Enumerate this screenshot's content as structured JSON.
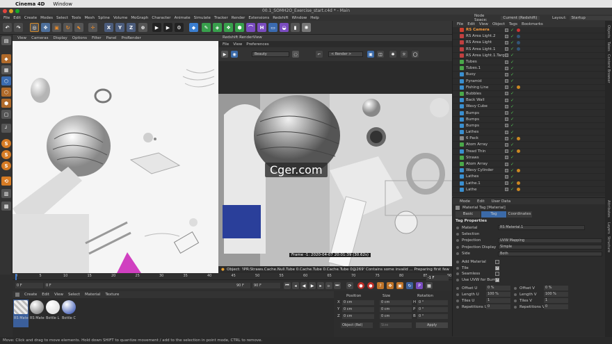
{
  "macmenu": {
    "app": "Cinema 4D",
    "window": "Window"
  },
  "window_title": "00.1_SOMH2O_Exercise_start.c4d * - Main",
  "appmenu": [
    "File",
    "Edit",
    "Create",
    "Modes",
    "Select",
    "Tools",
    "Mesh",
    "Spline",
    "Volume",
    "MoGraph",
    "Character",
    "Animate",
    "Simulate",
    "Tracker",
    "Render",
    "Extensions",
    "Redshift",
    "Window",
    "Help"
  ],
  "nodespace": {
    "label": "Node Space:",
    "value": "Current (Redshift)"
  },
  "layout": {
    "label": "Layout:",
    "value": "Startup"
  },
  "axes": [
    "X",
    "Y",
    "Z"
  ],
  "viewport_menu": [
    "View",
    "Cameras",
    "Display",
    "Options",
    "Filter",
    "Panel",
    "ProRender"
  ],
  "renderview": {
    "title": "Redshift RenderView",
    "menu": [
      "File",
      "View",
      "Preferences"
    ],
    "aov": "Beauty",
    "camera": "< Render >",
    "frame_info": "Frame -1:  2020-04-07  20:01:39  (30.62s)",
    "status": "Object: 'IPR:Straws.Cache.Null.Tube 0.Cache.Tube 0.Cache.Tube 0@269' Contains some invalid ...   Preparing first few levels of ray tr"
  },
  "watermark": "Cger.com",
  "timeline": {
    "ticks": [
      "0",
      "5",
      "10",
      "15",
      "20",
      "25",
      "30",
      "35",
      "40",
      "45",
      "50",
      "55",
      "60",
      "65",
      "70",
      "75",
      "80",
      "85",
      "90"
    ],
    "start": "0 F",
    "current": "0 F",
    "end": "90 F",
    "end2": "90 F",
    "frame_field": "-1 F"
  },
  "material_menu": [
    "Create",
    "Edit",
    "View",
    "Select",
    "Material",
    "Texture"
  ],
  "materials": [
    {
      "label": "RS Mate",
      "color": "#cfcfcf"
    },
    {
      "label": "RS Mate",
      "color": "#6a6a6a"
    },
    {
      "label": "Bottle L",
      "color": "#d8d8d8"
    },
    {
      "label": "Bottle C",
      "color": "#1e3fa8"
    }
  ],
  "coords": {
    "headers": [
      "Position",
      "Size",
      "Rotation"
    ],
    "rows": [
      {
        "axis": "X",
        "pos": "0 cm",
        "size": "0 cm",
        "rot_label": "H",
        "rot": "0 °"
      },
      {
        "axis": "Y",
        "pos": "0 cm",
        "size": "0 cm",
        "rot_label": "P",
        "rot": "0 °"
      },
      {
        "axis": "Z",
        "pos": "0 cm",
        "size": "0 cm",
        "rot_label": "B",
        "rot": "0 °"
      }
    ],
    "mode": "Object (Rel)",
    "size_mode": "Size",
    "apply": "Apply"
  },
  "object_menu": [
    "File",
    "Edit",
    "View",
    "Object",
    "Tags",
    "Bookmarks"
  ],
  "objects": [
    {
      "name": "RS Camera",
      "color": "#d04030",
      "tag": "#c33",
      "highlight": true
    },
    {
      "name": "RS Area Light.2",
      "color": "#c04040",
      "tag": "#357"
    },
    {
      "name": "RS Area Light",
      "color": "#c04040",
      "tag": "#357"
    },
    {
      "name": "RS Area Light.1",
      "color": "#c04040",
      "tag": "#357"
    },
    {
      "name": "RS Area Light.1.Target",
      "color": "#c04040",
      "tag": ""
    },
    {
      "name": "Tubes",
      "color": "#4aa84a",
      "tag": ""
    },
    {
      "name": "Tubes.1",
      "color": "#4aa84a",
      "tag": ""
    },
    {
      "name": "Buoy",
      "color": "#3a8fd0",
      "tag": ""
    },
    {
      "name": "Pyramid",
      "color": "#3a8fd0",
      "tag": ""
    },
    {
      "name": "Fishing Line",
      "color": "#3a8fd0",
      "tag": "#c82"
    },
    {
      "name": "Bubbles",
      "color": "#4aa84a",
      "tag": ""
    },
    {
      "name": "Back Wall",
      "color": "#3a8fd0",
      "tag": ""
    },
    {
      "name": "Wavy Cube",
      "color": "#3a8fd0",
      "tag": ""
    },
    {
      "name": "Bumps",
      "color": "#3a8fd0",
      "tag": ""
    },
    {
      "name": "Bumps",
      "color": "#3a8fd0",
      "tag": ""
    },
    {
      "name": "Bumps",
      "color": "#3a8fd0",
      "tag": ""
    },
    {
      "name": "Lathes",
      "color": "#3a8fd0",
      "tag": ""
    },
    {
      "name": "6 Pack",
      "color": "#888888",
      "tag": "#c82"
    },
    {
      "name": "Atom Array",
      "color": "#4aa84a",
      "tag": ""
    },
    {
      "name": "Tread Thin",
      "color": "#3a8fd0",
      "tag": "#c82"
    },
    {
      "name": "Straws",
      "color": "#4aa84a",
      "tag": ""
    },
    {
      "name": "Atom Array",
      "color": "#4aa84a",
      "tag": ""
    },
    {
      "name": "Wavy Cylinder",
      "color": "#3a8fd0",
      "tag": "#c82"
    },
    {
      "name": "Lathes",
      "color": "#3a8fd0",
      "tag": ""
    },
    {
      "name": "Lathe.1",
      "color": "#3a8fd0",
      "tag": "#c82"
    },
    {
      "name": "Lathe",
      "color": "#3a8fd0",
      "tag": "#c82"
    }
  ],
  "attributes": {
    "menu": [
      "Mode",
      "Edit",
      "User Data"
    ],
    "header": "Material Tag [Material]",
    "tabs": [
      "Basic",
      "Tag",
      "Coordinates"
    ],
    "section": "Tag Properties",
    "props": [
      {
        "label": "Material",
        "value": "RS Material.1"
      },
      {
        "label": "Selection",
        "value": ""
      },
      {
        "label": "Projection",
        "value": "UVW Mapping"
      },
      {
        "label": "Projection Display",
        "value": "Simple"
      },
      {
        "label": "Side",
        "value": "Both"
      }
    ],
    "checks": [
      {
        "label": "Add Material",
        "checked": false
      },
      {
        "label": "Tile",
        "checked": true
      },
      {
        "label": "Seamless",
        "checked": false
      },
      {
        "label": "Use UVW for Bump",
        "checked": true
      }
    ],
    "pairs": [
      {
        "l1": "Offset U",
        "v1": "0 %",
        "l2": "Offset V",
        "v2": "0 %"
      },
      {
        "l1": "Length U",
        "v1": "100 %",
        "l2": "Length V",
        "v2": "100 %"
      },
      {
        "l1": "Tiles U",
        "v1": "1",
        "l2": "Tiles V",
        "v2": "1"
      },
      {
        "l1": "Repetitions U",
        "v1": "0",
        "l2": "Repetitions V",
        "v2": "0"
      }
    ]
  },
  "side_tabs": [
    "Objects",
    "Takes",
    "Content Browser",
    "Attributes",
    "Layers",
    "Structure"
  ],
  "statusbar": "Move: Click and drag to move elements. Hold down SHIFT to quantize movement / add to the selection in point mode, CTRL to remove."
}
